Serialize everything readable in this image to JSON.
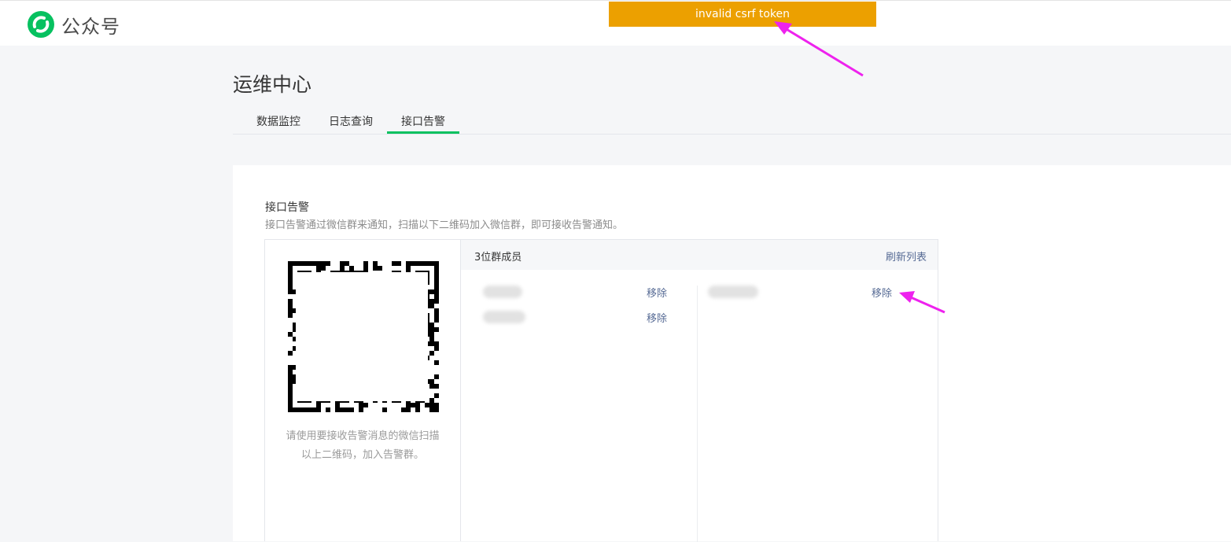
{
  "header": {
    "brand": "公众号"
  },
  "toast": {
    "message": "invalid csrf token"
  },
  "page": {
    "title": "运维中心"
  },
  "tabs": [
    {
      "label": "数据监控",
      "active": false
    },
    {
      "label": "日志查询",
      "active": false
    },
    {
      "label": "接口告警",
      "active": true
    }
  ],
  "alert": {
    "title": "接口告警",
    "description": "接口告警通过微信群来通知，扫描以下二维码加入微信群，即可接收告警通知。",
    "qr_hint": "请使用要接收告警消息的微信扫描以上二维码，加入告警群。",
    "members_count_label": "3位群成员",
    "refresh_label": "刷新列表",
    "remove_label": "移除"
  },
  "colors": {
    "accent": "#07c160",
    "toast": "#eca000",
    "link": "#576b95",
    "annotation": "#ee22ee"
  },
  "icons": {
    "logo": "wechat-official-account-logo-icon",
    "qr": "qr-code-icon"
  }
}
